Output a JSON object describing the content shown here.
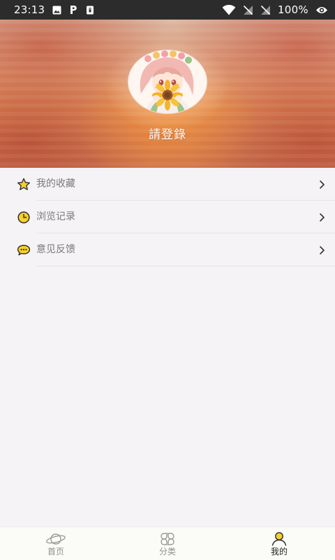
{
  "status_bar": {
    "time": "23:13",
    "battery": "100%",
    "left_icons": [
      "image-icon",
      "parking-p-icon",
      "sim-icon"
    ],
    "right_icons": [
      "wifi-icon",
      "signal-off-icon",
      "signal-off-icon",
      "eye-icon"
    ]
  },
  "header": {
    "avatar_icon": "avatar-girl-sunflower",
    "login_text": "請登錄"
  },
  "menu": {
    "items": [
      {
        "label": "我的收藏",
        "icon": "star-icon"
      },
      {
        "label": "浏览记录",
        "icon": "clock-icon"
      },
      {
        "label": "意见反馈",
        "icon": "chat-bubble-icon"
      }
    ],
    "chevron_icon": "chevron-right-icon"
  },
  "bottom_nav": {
    "items": [
      {
        "label": "首页",
        "icon": "planet-icon",
        "active": false
      },
      {
        "label": "分类",
        "icon": "grid-petals-icon",
        "active": false
      },
      {
        "label": "我的",
        "icon": "user-icon",
        "active": true
      }
    ]
  },
  "colors": {
    "accent_yellow": "#f7cf2a",
    "status_bar_bg": "#2c2c2c",
    "page_bg": "#f5f3f6",
    "nav_bg": "#fbfbf7"
  }
}
